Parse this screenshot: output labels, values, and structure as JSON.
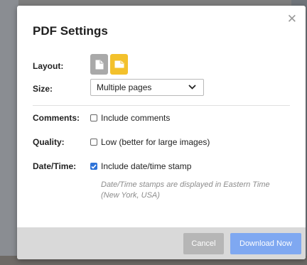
{
  "dialog": {
    "title": "PDF Settings",
    "close_icon": "close-icon",
    "layout": {
      "label": "Layout:",
      "options": [
        "portrait",
        "landscape"
      ],
      "selected": "landscape"
    },
    "size": {
      "label": "Size:",
      "value": "Multiple pages"
    },
    "comments": {
      "label": "Comments:",
      "checkbox_label": "Include comments",
      "checked": false
    },
    "quality": {
      "label": "Quality:",
      "checkbox_label": "Low (better for large images)",
      "checked": false
    },
    "datetime": {
      "label": "Date/Time:",
      "checkbox_label": "Include date/time stamp",
      "checked": true,
      "note": "Date/Time stamps are displayed in Eastern Time (New York, USA)"
    },
    "buttons": {
      "cancel": "Cancel",
      "download": "Download Now"
    }
  },
  "colors": {
    "accent": "#f3c12c",
    "primary_button": "#7fa8f1",
    "checkbox": "#2e73d8"
  }
}
